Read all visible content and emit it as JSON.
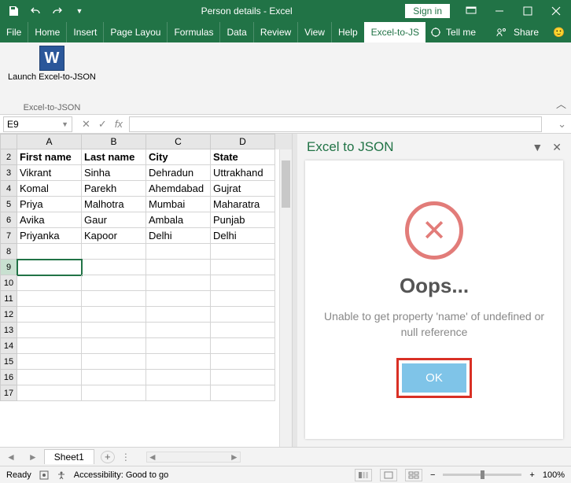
{
  "titlebar": {
    "title": "Person details - Excel",
    "signin": "Sign in"
  },
  "tabs": {
    "file": "File",
    "home": "Home",
    "insert": "Insert",
    "pagelayout": "Page Layou",
    "formulas": "Formulas",
    "data": "Data",
    "review": "Review",
    "view": "View",
    "help": "Help",
    "addin": "Excel-to-JS",
    "tellme": "Tell me",
    "share": "Share"
  },
  "ribbon": {
    "launch_label": "Launch Excel-to-JSON",
    "group": "Excel-to-JSON"
  },
  "namebox": {
    "value": "E9",
    "fx": "fx"
  },
  "columns": [
    "A",
    "B",
    "C",
    "D"
  ],
  "headers": [
    "First name",
    "Last name",
    "City",
    "State"
  ],
  "rows": [
    [
      "Vikrant",
      "Sinha",
      "Dehradun",
      "Uttrakhand"
    ],
    [
      "Komal",
      "Parekh",
      "Ahemdabad",
      "Gujrat"
    ],
    [
      "Priya",
      "Malhotra",
      "Mumbai",
      "Maharatra"
    ],
    [
      "Avika",
      "Gaur",
      "Ambala",
      "Punjab"
    ],
    [
      "Priyanka",
      "Kapoor",
      "Delhi",
      "Delhi"
    ]
  ],
  "row_numbers": [
    "2",
    "3",
    "4",
    "5",
    "6",
    "7",
    "8",
    "9",
    "10",
    "11",
    "12",
    "13",
    "14",
    "15",
    "16",
    "17"
  ],
  "active_cell": {
    "row": 9,
    "col": 0
  },
  "pane": {
    "title": "Excel to JSON",
    "oops": "Oops...",
    "message": "Unable to get property 'name' of undefined or null reference",
    "ok": "OK"
  },
  "sheet_tabs": {
    "sheet1": "Sheet1"
  },
  "statusbar": {
    "ready": "Ready",
    "accessibility": "Accessibility: Good to go",
    "zoom": "100%"
  }
}
